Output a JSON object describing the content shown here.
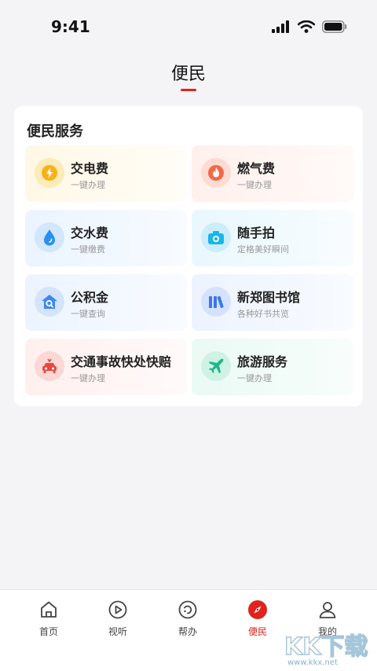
{
  "status": {
    "time": "9:41"
  },
  "page": {
    "title": "便民"
  },
  "card": {
    "title": "便民服务",
    "tiles": [
      {
        "title": "交电费",
        "subtitle": "一键办理",
        "icon": "lightning-icon",
        "color": "#f7b11b"
      },
      {
        "title": "燃气费",
        "subtitle": "一键办理",
        "icon": "flame-icon",
        "color": "#f06a47"
      },
      {
        "title": "交水费",
        "subtitle": "一键缴费",
        "icon": "water-drop-icon",
        "color": "#2a8ff0"
      },
      {
        "title": "随手拍",
        "subtitle": "定格美好瞬间",
        "icon": "camera-icon",
        "color": "#19b6e8"
      },
      {
        "title": "公积金",
        "subtitle": "一键查询",
        "icon": "house-search-icon",
        "color": "#3e86f2"
      },
      {
        "title": "新郑图书馆",
        "subtitle": "各种好书共览",
        "icon": "books-icon",
        "color": "#3878e8"
      },
      {
        "title": "交通事故快处快赔",
        "subtitle": "一键办理",
        "icon": "car-accident-icon",
        "color": "#e8473f"
      },
      {
        "title": "旅游服务",
        "subtitle": "一键办理",
        "icon": "airplane-icon",
        "color": "#1db98a"
      }
    ]
  },
  "tabbar": {
    "items": [
      {
        "label": "首页",
        "icon": "home-icon"
      },
      {
        "label": "视听",
        "icon": "play-icon"
      },
      {
        "label": "帮办",
        "icon": "help-icon"
      },
      {
        "label": "便民",
        "icon": "compass-icon",
        "active": true
      },
      {
        "label": "我的",
        "icon": "profile-icon"
      }
    ],
    "active_color": "#e0231d"
  },
  "watermark": {
    "logo": "KK下载",
    "url": "www.kkx.net"
  }
}
